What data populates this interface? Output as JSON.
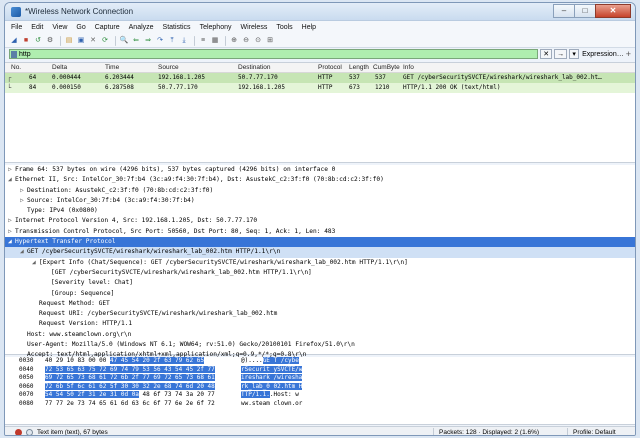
{
  "window": {
    "title": "*Wireless Network Connection",
    "min": "–",
    "max": "□",
    "close": "✕"
  },
  "menu": [
    "File",
    "Edit",
    "View",
    "Go",
    "Capture",
    "Analyze",
    "Statistics",
    "Telephony",
    "Wireless",
    "Tools",
    "Help"
  ],
  "toolbar_icons": [
    "fin-icon",
    "stop-icon",
    "restart-icon",
    "options-icon",
    "open-icon",
    "save-icon",
    "close-file-icon",
    "reload-icon",
    "find-icon",
    "back-icon",
    "forward-icon",
    "goto-icon",
    "first-icon",
    "last-icon",
    "autoscroll-icon",
    "colorize-icon",
    "zoom-in-icon",
    "zoom-out-icon",
    "zoom-reset-icon",
    "resize-columns-icon"
  ],
  "filter": {
    "value": "http",
    "clear": "✕",
    "apply": "→",
    "dropdown": "▾",
    "expression": "Expression…",
    "plus": "+"
  },
  "packet_list": {
    "headers": [
      "No.",
      "Delta",
      "Time",
      "Source",
      "Destination",
      "Protocol",
      "Length",
      "CumByte",
      "Info"
    ],
    "rows": [
      {
        "no": "64",
        "delta": "0.000444",
        "time": "6.203444",
        "src": "192.168.1.205",
        "dst": "50.7.77.170",
        "proto": "HTTP",
        "len": "537",
        "cum": "537",
        "info": "GET /cyberSecuritySVCTE/wireshark/wireshark_lab_002.ht…"
      },
      {
        "no": "84",
        "delta": "0.000150",
        "time": "6.287508",
        "src": "50.7.77.170",
        "dst": "192.168.1.205",
        "proto": "HTTP",
        "len": "673",
        "cum": "1210",
        "info": "HTTP/1.1 200 OK  (text/html)"
      }
    ]
  },
  "details": [
    {
      "a": "▷",
      "i": 0,
      "t": "Frame 64: 537 bytes on wire (4296 bits), 537 bytes captured (4296 bits) on interface 0"
    },
    {
      "a": "◢",
      "i": 0,
      "t": "Ethernet II, Src: IntelCor_30:7f:b4 (3c:a9:f4:30:7f:b4), Dst: AsustekC_c2:3f:f0 (70:8b:cd:c2:3f:f0)"
    },
    {
      "a": "▷",
      "i": 1,
      "t": "Destination: AsustekC_c2:3f:f0 (70:8b:cd:c2:3f:f0)"
    },
    {
      "a": "▷",
      "i": 1,
      "t": "Source: IntelCor_30:7f:b4 (3c:a9:f4:30:7f:b4)"
    },
    {
      "a": "",
      "i": 1,
      "t": "Type: IPv4 (0x0800)"
    },
    {
      "a": "▷",
      "i": 0,
      "t": "Internet Protocol Version 4, Src: 192.168.1.205, Dst: 50.7.77.170"
    },
    {
      "a": "▷",
      "i": 0,
      "t": "Transmission Control Protocol, Src Port: 50560, Dst Port: 80, Seq: 1, Ack: 1, Len: 483"
    },
    {
      "a": "◢",
      "i": 0,
      "t": "Hypertext Transfer Protocol",
      "hl": "hl"
    },
    {
      "a": "◢",
      "i": 1,
      "t": "GET /cyberSecuritySVCTE/wireshark/wireshark_lab_002.htm HTTP/1.1\\r\\n",
      "hl": "hl2"
    },
    {
      "a": "◢",
      "i": 2,
      "t": "[Expert Info (Chat/Sequence): GET /cyberSecuritySVCTE/wireshark/wireshark_lab_002.htm HTTP/1.1\\r\\n]"
    },
    {
      "a": "",
      "i": 3,
      "t": "[GET /cyberSecuritySVCTE/wireshark/wireshark_lab_002.htm HTTP/1.1\\r\\n]"
    },
    {
      "a": "",
      "i": 3,
      "t": "[Severity level: Chat]"
    },
    {
      "a": "",
      "i": 3,
      "t": "[Group: Sequence]"
    },
    {
      "a": "",
      "i": 2,
      "t": "Request Method: GET"
    },
    {
      "a": "",
      "i": 2,
      "t": "Request URI: /cyberSecuritySVCTE/wireshark/wireshark_lab_002.htm"
    },
    {
      "a": "",
      "i": 2,
      "t": "Request Version: HTTP/1.1"
    },
    {
      "a": "",
      "i": 1,
      "t": "Host: www.steamclown.org\\r\\n"
    },
    {
      "a": "",
      "i": 1,
      "t": "User-Agent: Mozilla/5.0 (Windows NT 6.1; WOW64; rv:51.0) Gecko/20100101 Firefox/51.0\\r\\n"
    },
    {
      "a": "",
      "i": 1,
      "t": "Accept: text/html,application/xhtml+xml,application/xml;q=0.9,*/*;q=0.8\\r\\n"
    },
    {
      "a": "",
      "i": 1,
      "t": "Accept-Language: en-US,en;q=0.5\\r\\n"
    }
  ],
  "hex": [
    {
      "off": "0030",
      "pre": "40 29 10 83 00 00 ",
      "sel": "47 45  54 20 2f 63 79 62 65",
      "post": "",
      "apre": "@)....",
      "asel": "GE T /cybe",
      "apost": ""
    },
    {
      "off": "0040",
      "pre": "",
      "sel": "72 53 65 63 75 72 69 74  79 53 56 43 54 45 2f 77",
      "post": "",
      "apre": "",
      "asel": "rSecurit ySVCTE/w",
      "apost": ""
    },
    {
      "off": "0050",
      "pre": "",
      "sel": "69 72 65 73 68 61 72 6b  2f 77 69 72 65 73 68 61",
      "post": "",
      "apre": "",
      "asel": "ireshark /wiresha",
      "apost": ""
    },
    {
      "off": "0060",
      "pre": "",
      "sel": "72 6b 5f 6c 61 62 5f 30  30 32 2e 68 74 6d 20 48",
      "post": "",
      "apre": "",
      "asel": "rk_lab_0 02.htm H",
      "apost": ""
    },
    {
      "off": "0070",
      "pre": "",
      "sel": "54 54 50 2f 31 2e 31 0d  0a",
      "post": " 48 6f 73 74 3a 20 77",
      "apre": "",
      "asel": "TTP/1.1.",
      "apost": ".Host: w"
    },
    {
      "off": "0080",
      "pre": "77 77 2e 73 74 65 61 6d  63 6c 6f 77 6e 2e 6f 72",
      "sel": "",
      "post": "",
      "apre": "ww.steam clown.or",
      "asel": "",
      "apost": ""
    }
  ],
  "status": {
    "text": "Text item (text), 67 bytes",
    "packets": "Packets: 128 · Displayed: 2 (1.6%)",
    "profile": "Profile: Default"
  },
  "colors": {
    "selected_row": "#c6e5b4",
    "highlight": "#3875d7",
    "filter_ok": "#afeeaf"
  }
}
